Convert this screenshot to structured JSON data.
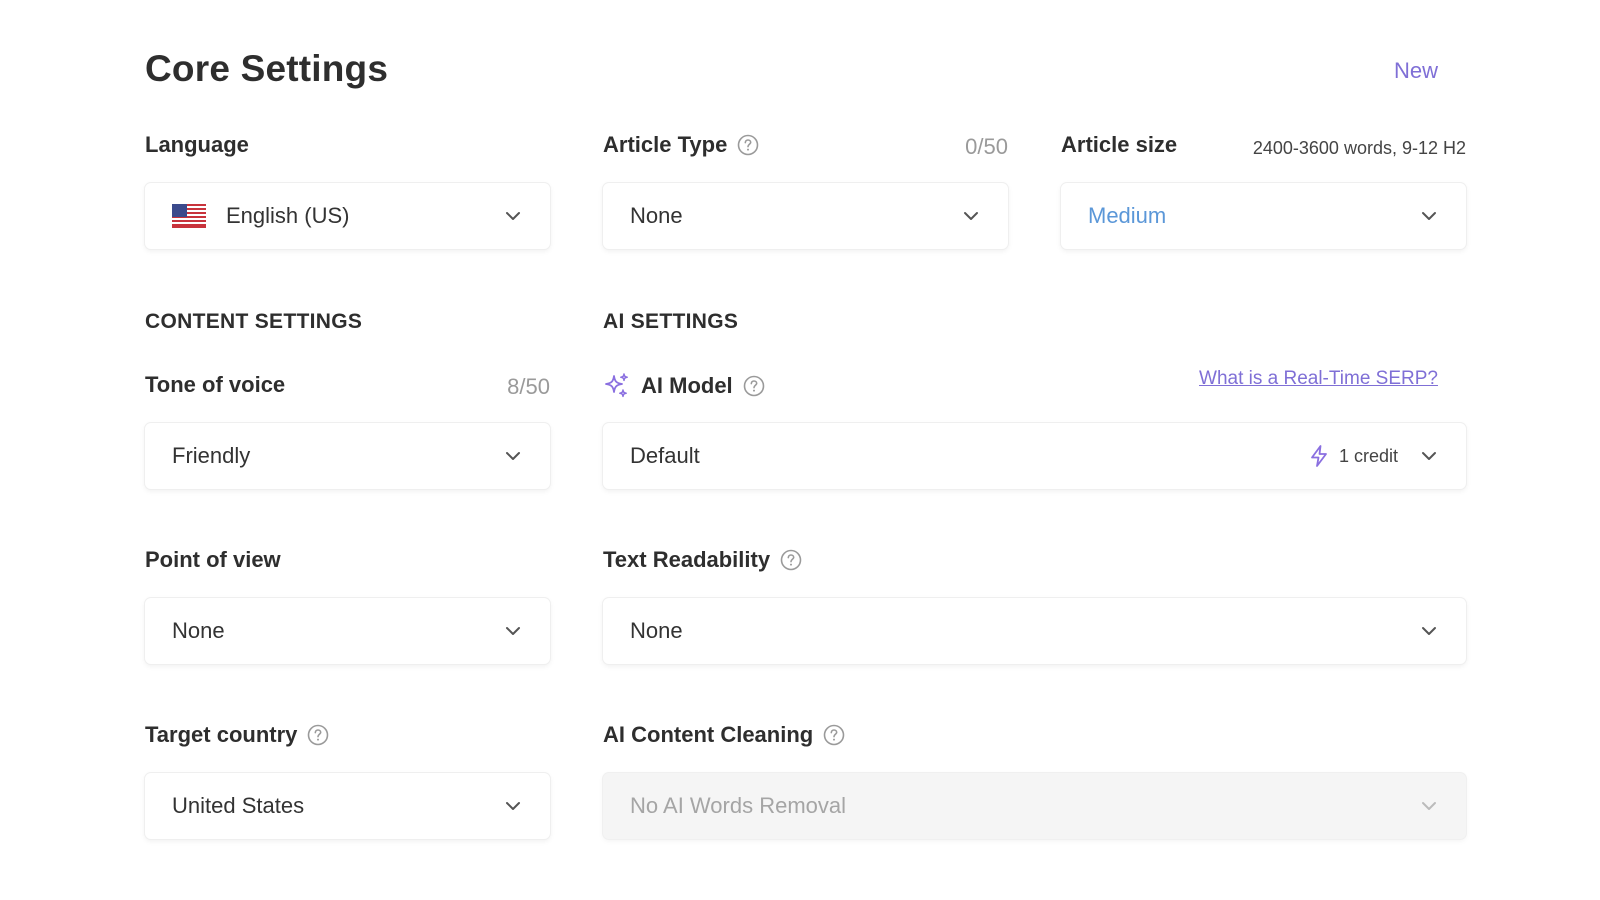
{
  "page": {
    "title": "Core Settings",
    "new_label": "New"
  },
  "language": {
    "label": "Language",
    "value": "English (US)",
    "flag_icon": "us-flag-icon"
  },
  "article_type": {
    "label": "Article Type",
    "counter": "0/50",
    "value": "None"
  },
  "article_size": {
    "label": "Article size",
    "meta": "2400-3600 words, 9-12 H2",
    "value": "Medium"
  },
  "sections": {
    "content": "CONTENT SETTINGS",
    "ai": "AI SETTINGS"
  },
  "tone": {
    "label": "Tone of voice",
    "counter": "8/50",
    "value": "Friendly"
  },
  "ai_model": {
    "label": "AI Model",
    "link": "What is a Real-Time SERP?",
    "value": "Default",
    "credit": "1 credit"
  },
  "point_of_view": {
    "label": "Point of view",
    "value": "None"
  },
  "readability": {
    "label": "Text Readability",
    "value": "None"
  },
  "target_country": {
    "label": "Target country",
    "value": "United States"
  },
  "ai_cleaning": {
    "label": "AI Content Cleaning",
    "value": "No AI Words Removal"
  },
  "colors": {
    "accent": "#7f6fd6",
    "blue_value": "#5b97d8",
    "muted": "#9a9a9a"
  }
}
